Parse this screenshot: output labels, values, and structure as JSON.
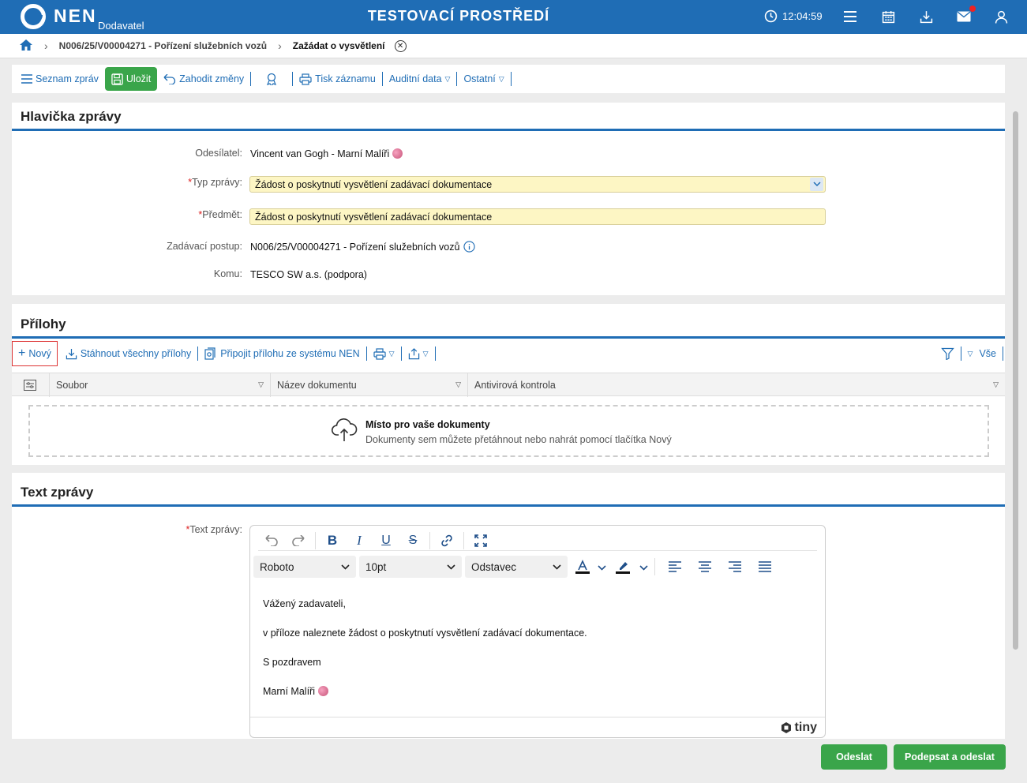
{
  "app": {
    "brand": "NEN",
    "brand_sub": "Dodavatel",
    "env_title": "TESTOVACÍ PROSTŘEDÍ",
    "clock": "12:04:59"
  },
  "icons": {
    "clock": "clock-icon",
    "menu": "hamburger-menu-icon",
    "calendar": "calendar-icon",
    "download": "download-icon",
    "mail": "mail-icon",
    "user": "user-icon",
    "home": "home-icon"
  },
  "colors": {
    "primary": "#1f6db5",
    "success": "#3aa54a",
    "required_field": "#fdf6c4",
    "notification": "#e22222"
  },
  "breadcrumb": {
    "item1": "N006/25/V00004271 - Pořízení služebních vozů",
    "current": "Zažádat o vysvětlení"
  },
  "toolbar": {
    "list": "Seznam zpráv",
    "save": "Uložit",
    "discard": "Zahodit změny",
    "print": "Tisk záznamu",
    "audit": "Auditní data",
    "other": "Ostatní"
  },
  "header_section": {
    "title": "Hlavička zprávy",
    "sender_label": "Odesílatel:",
    "sender_value": "Vincent van Gogh - Marní Malíři",
    "type_label": "Typ zprávy:",
    "type_value": "Žádost o poskytnutí vysvětlení zadávací dokumentace",
    "subject_label": "Předmět:",
    "subject_value": "Žádost o poskytnutí vysvětlení zadávací dokumentace",
    "procedure_label": "Zadávací postup:",
    "procedure_value": "N006/25/V00004271 - Pořízení služebních vozů",
    "to_label": "Komu:",
    "to_value": "TESCO SW a.s. (podpora)"
  },
  "attachments": {
    "title": "Přílohy",
    "new": "Nový",
    "download_all": "Stáhnout všechny přílohy",
    "attach_nen": "Připojit přílohu ze systému NEN",
    "filter_all": "Vše",
    "columns": [
      "Soubor",
      "Název dokumentu",
      "Antivirová kontrola"
    ],
    "drop_title": "Místo pro vaše dokumenty",
    "drop_text": "Dokumenty sem můžete přetáhnout nebo nahrát pomocí tlačítka Nový"
  },
  "message": {
    "title": "Text zprávy",
    "label": "Text zprávy:",
    "font": "Roboto",
    "size": "10pt",
    "block": "Odstavec",
    "lines": [
      "Vážený zadavateli,",
      "v příloze naleznete žádost o poskytnutí vysvětlení zadávací dokumentace.",
      "S pozdravem",
      "Marní Malíři"
    ],
    "tiny": "tiny"
  },
  "actions": {
    "send": "Odeslat",
    "sign_send": "Podepsat a odeslat"
  }
}
